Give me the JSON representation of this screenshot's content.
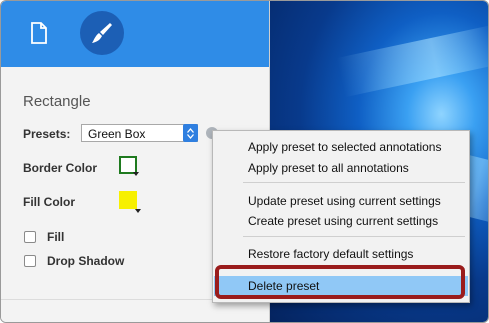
{
  "toolbar": {
    "doc_icon": "document-icon",
    "brush_icon": "brush-icon"
  },
  "panel": {
    "section_title": "Rectangle",
    "presets_label": "Presets:",
    "presets_value": "Green Box",
    "border_color_label": "Border Color",
    "fill_color_label": "Fill Color",
    "fill_label": "Fill",
    "drop_shadow_label": "Drop Shadow",
    "border_color": "#1f7a1f",
    "fill_color": "#f7f000"
  },
  "menu": {
    "items": [
      "Apply preset to selected annotations",
      "Apply preset to all annotations",
      "Update preset using current settings",
      "Create preset using current settings",
      "Restore factory default settings",
      "Delete preset"
    ]
  },
  "colors": {
    "accent": "#2f8ce7",
    "menu_highlight": "#90c8f6",
    "callout_ring": "#9a1c1c"
  }
}
